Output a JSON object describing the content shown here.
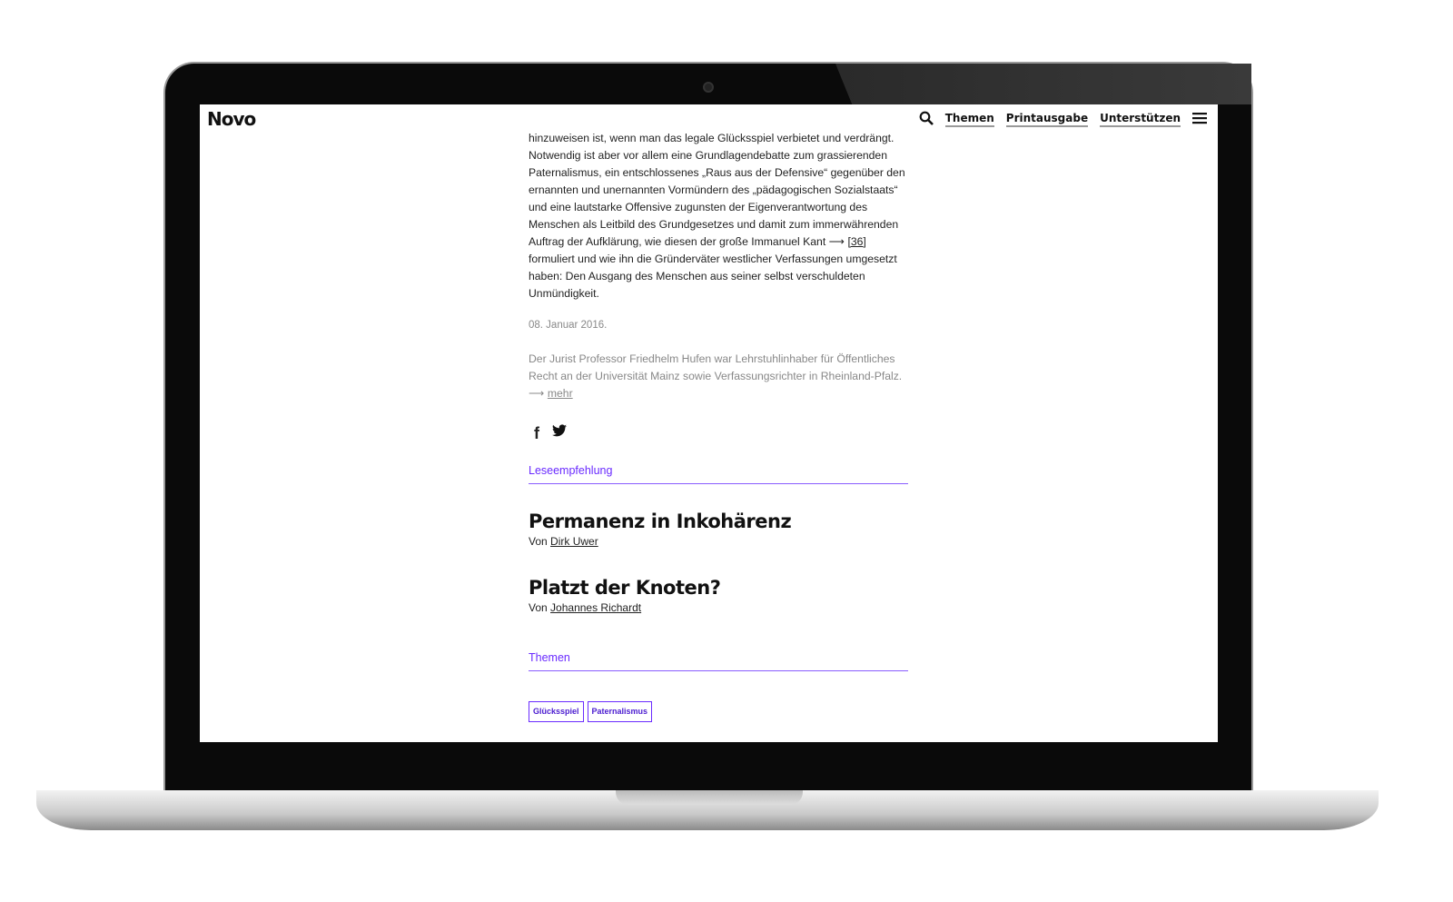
{
  "header": {
    "logo": "Novo",
    "nav": [
      "Themen",
      "Printausgabe",
      "Unterstützen"
    ]
  },
  "article": {
    "paragraph": "hinzuweisen ist, wenn man das legale Glücksspiel verbietet und verdrängt. Notwendig ist aber vor allem eine Grundlagendebatte zum grassierenden Paternalismus, ein entschlossenes „Raus aus der Defensive“ gegenüber den ernannten und unernannten Vormündern des „pädagogischen Sozialstaats“ und eine lautstarke Offensive zugunsten der Eigenverantwortung des Menschen als Leitbild des Grundgesetzes und damit zum immerwährenden Auftrag der Aufklärung, wie diesen der große Immanuel Kant",
    "footnote": "[36]",
    "paragraph_end": "formuliert und wie ihn die Gründerväter westlicher Verfassungen umgesetzt haben: Den Ausgang des Menschen aus seiner selbst verschuldeten Unmündigkeit.",
    "date": "08. Januar 2016.",
    "author_bio": "Der Jurist Professor Friedhelm Hufen war Lehrstuhlinhaber für Öffentliches Recht an der Universität Mainz sowie Verfassungsrichter in Rheinland-Pfalz.",
    "more": "mehr",
    "arrow": "⟶"
  },
  "recommend": {
    "label": "Leseempfehlung",
    "items": [
      {
        "title": "Permanenz in Inkohärenz",
        "by": "Von",
        "author": "Dirk Uwer"
      },
      {
        "title": "Platzt der Knoten?",
        "by": "Von",
        "author": "Johannes Richardt"
      }
    ]
  },
  "topics": {
    "label": "Themen",
    "tags": [
      "Glücksspiel",
      "Paternalismus"
    ]
  }
}
